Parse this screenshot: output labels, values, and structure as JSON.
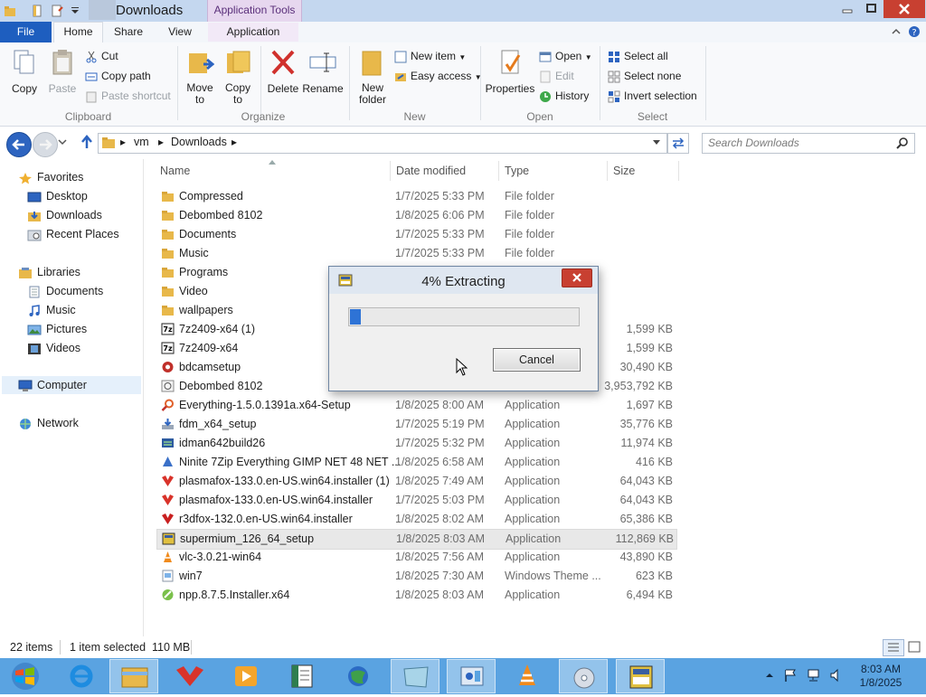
{
  "window": {
    "title": "Downloads",
    "context_tab_header": "Application Tools",
    "controls": {
      "minimize_icon": "minimize-icon",
      "maximize_icon": "maximize-icon",
      "close_icon": "close-icon"
    }
  },
  "tabs": {
    "file": "File",
    "home": "Home",
    "share": "Share",
    "view": "View",
    "application": "Application"
  },
  "ribbon": {
    "clipboard": {
      "label": "Clipboard",
      "copy": "Copy",
      "paste": "Paste",
      "cut": "Cut",
      "copy_path": "Copy path",
      "paste_shortcut": "Paste shortcut"
    },
    "organize": {
      "label": "Organize",
      "move_to": "Move to",
      "copy_to": "Copy to",
      "delete": "Delete",
      "rename": "Rename"
    },
    "new": {
      "label": "New",
      "new_folder": "New folder",
      "new_item": "New item",
      "easy_access": "Easy access"
    },
    "open": {
      "label": "Open",
      "properties": "Properties",
      "open": "Open",
      "edit": "Edit",
      "history": "History"
    },
    "select": {
      "label": "Select",
      "select_all": "Select all",
      "select_none": "Select none",
      "invert_selection": "Invert selection"
    }
  },
  "address": {
    "crumbs": [
      "vm",
      "Downloads"
    ],
    "search_placeholder": "Search Downloads"
  },
  "navpane": {
    "favorites": "Favorites",
    "desktop": "Desktop",
    "downloads": "Downloads",
    "recent": "Recent Places",
    "libraries": "Libraries",
    "documents": "Documents",
    "music": "Music",
    "pictures": "Pictures",
    "videos": "Videos",
    "computer": "Computer",
    "network": "Network"
  },
  "columns": {
    "name": "Name",
    "date": "Date modified",
    "type": "Type",
    "size": "Size"
  },
  "files": [
    {
      "name": "Compressed",
      "date": "1/7/2025 5:33 PM",
      "type": "File folder",
      "size": ""
    },
    {
      "name": "Debombed 8102",
      "date": "1/8/2025 6:06 PM",
      "type": "File folder",
      "size": ""
    },
    {
      "name": "Documents",
      "date": "1/7/2025 5:33 PM",
      "type": "File folder",
      "size": ""
    },
    {
      "name": "Music",
      "date": "1/7/2025 5:33 PM",
      "type": "File folder",
      "size": ""
    },
    {
      "name": "Programs",
      "date": "",
      "type": "",
      "size": ""
    },
    {
      "name": "Video",
      "date": "",
      "type": "",
      "size": ""
    },
    {
      "name": "wallpapers",
      "date": "",
      "type": "",
      "size": ""
    },
    {
      "name": "7z2409-x64 (1)",
      "date": "",
      "type": "",
      "size": "1,599 KB"
    },
    {
      "name": "7z2409-x64",
      "date": "",
      "type": "",
      "size": "1,599 KB"
    },
    {
      "name": "bdcamsetup",
      "date": "",
      "type": "",
      "size": "30,490 KB"
    },
    {
      "name": "Debombed 8102",
      "date": "",
      "type": "",
      "size": "3,953,792 KB"
    },
    {
      "name": "Everything-1.5.0.1391a.x64-Setup",
      "date": "1/8/2025 8:00 AM",
      "type": "Application",
      "size": "1,697 KB"
    },
    {
      "name": "fdm_x64_setup",
      "date": "1/7/2025 5:19 PM",
      "type": "Application",
      "size": "35,776 KB"
    },
    {
      "name": "idman642build26",
      "date": "1/7/2025 5:32 PM",
      "type": "Application",
      "size": "11,974 KB"
    },
    {
      "name": "Ninite 7Zip Everything GIMP NET 48 NET ...",
      "date": "1/8/2025 6:58 AM",
      "type": "Application",
      "size": "416 KB"
    },
    {
      "name": "plasmafox-133.0.en-US.win64.installer (1)",
      "date": "1/8/2025 7:49 AM",
      "type": "Application",
      "size": "64,043 KB"
    },
    {
      "name": "plasmafox-133.0.en-US.win64.installer",
      "date": "1/7/2025 5:03 PM",
      "type": "Application",
      "size": "64,043 KB"
    },
    {
      "name": "r3dfox-132.0.en-US.win64.installer",
      "date": "1/8/2025 8:02 AM",
      "type": "Application",
      "size": "65,386 KB"
    },
    {
      "name": "supermium_126_64_setup",
      "date": "1/8/2025 8:03 AM",
      "type": "Application",
      "size": "112,869 KB"
    },
    {
      "name": "vlc-3.0.21-win64",
      "date": "1/8/2025 7:56 AM",
      "type": "Application",
      "size": "43,890 KB"
    },
    {
      "name": "win7",
      "date": "1/8/2025 7:30 AM",
      "type": "Windows Theme ...",
      "size": "623 KB"
    },
    {
      "name": "npp.8.7.5.Installer.x64",
      "date": "1/8/2025 8:03 AM",
      "type": "Application",
      "size": "6,494 KB"
    }
  ],
  "status": {
    "items": "22 items",
    "selected": "1 item selected  110 MB"
  },
  "dialog": {
    "title": "4% Extracting",
    "progress": 0.04,
    "cancel": "Cancel"
  },
  "taskbar": {
    "time": "8:03 AM",
    "date": "1/8/2025"
  },
  "colors": {
    "accent": "#1e5ebf",
    "taskbar": "#5aa3e1",
    "progress": "#2e73d6",
    "close": "#c84031"
  }
}
